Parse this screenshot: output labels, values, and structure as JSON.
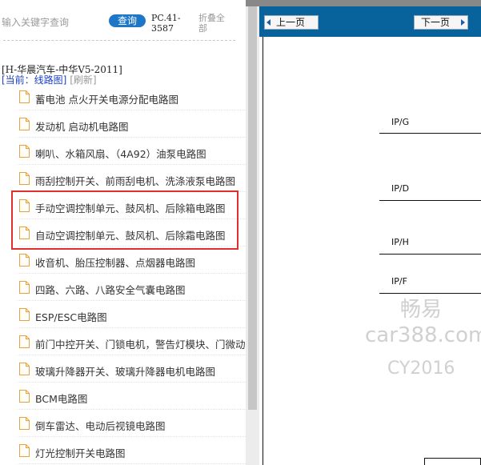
{
  "toolbar": {
    "search_placeholder": "输入关键字查询",
    "query_label": "查询",
    "pc_code": "PC.41-3587",
    "collapse_label": "折叠全部"
  },
  "tree": {
    "car_title": "[H-华晨汽车-中华V5-2011]",
    "current_label": "[当前：线路图]",
    "refresh_label": "[刷新]",
    "items": [
      {
        "label": "蓄电池 点火开关电源分配电路图"
      },
      {
        "label": "发动机 启动机电路图"
      },
      {
        "label": "喇叭、水箱风扇、（4A92）油泵电路图"
      },
      {
        "label": "雨刮控制开关、前雨刮电机、洗涤液泵电路图"
      },
      {
        "label": "手动空调控制单元、鼓风机、后除箱电路图",
        "highlighted": true
      },
      {
        "label": "自动空调控制单元、鼓风机、后除霜电路图",
        "highlighted": true
      },
      {
        "label": "收音机、胎压控制器、点烟器电路图"
      },
      {
        "label": "四路、六路、八路安全气囊电路图"
      },
      {
        "label": "ESP/ESC电路图"
      },
      {
        "label": "前门中控开关、门锁电机，警告灯模块、门微动"
      },
      {
        "label": "玻璃升降器开关、玻璃升降器电机电路图"
      },
      {
        "label": "BCM电路图"
      },
      {
        "label": "倒车雷达、电动后视镜电路图"
      },
      {
        "label": "灯光控制开关电路图"
      }
    ]
  },
  "viewer": {
    "prev_label": "上一页",
    "next_label": "下一页",
    "signals": [
      "IP/G",
      "IP/D",
      "IP/H",
      "IP/F"
    ],
    "watermark": {
      "line1": "畅易",
      "line2": "car388.com",
      "line3": "CY2016"
    }
  },
  "colors": {
    "nav_bar": "#08629b",
    "query_button": "#1e76c6",
    "highlight_border": "#e0302e"
  }
}
